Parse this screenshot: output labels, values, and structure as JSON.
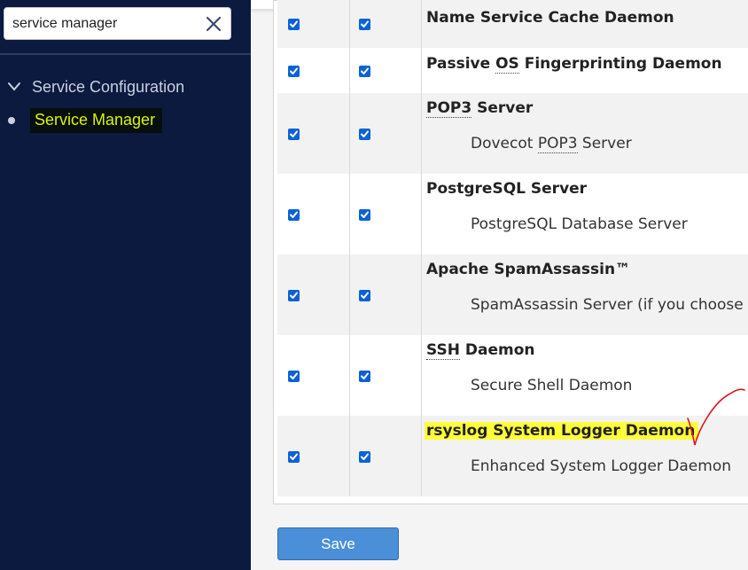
{
  "sidebar": {
    "search": {
      "value": "service manager",
      "placeholder": ""
    },
    "group_label": "Service Configuration",
    "item_label": "Service Manager"
  },
  "services": [
    {
      "name_parts": [
        "Name Service Cache Daemon"
      ],
      "description": "",
      "enabled": true,
      "monitor": true
    },
    {
      "name_parts": [
        "Passive ",
        "OS",
        " Fingerprinting Daemon"
      ],
      "description": "",
      "enabled": true,
      "monitor": true
    },
    {
      "name_parts": [
        "POP3",
        " Server"
      ],
      "desc_parts": [
        "Dovecot ",
        "POP3",
        " Server"
      ],
      "enabled": true,
      "monitor": true
    },
    {
      "name_parts": [
        "PostgreSQL Server"
      ],
      "description": "PostgreSQL Database Server",
      "enabled": true,
      "monitor": true
    },
    {
      "name_parts": [
        "Apache SpamAssassin™"
      ],
      "description": "SpamAssassin Server (if you choose to",
      "enabled": true,
      "monitor": true
    },
    {
      "name_parts": [
        "SSH",
        " Daemon"
      ],
      "description": "Secure Shell Daemon",
      "enabled": true,
      "monitor": true
    },
    {
      "name_parts": [
        "rsyslog System Logger Daemon"
      ],
      "description": "Enhanced System Logger Daemon",
      "enabled": true,
      "monitor": true,
      "highlighted": true
    }
  ],
  "save_label": "Save",
  "colors": {
    "sidebar_bg": "#0c1a40",
    "accent": "#0b62d6",
    "highlight": "#ffff3b",
    "save_bg": "#4a8fd7",
    "annotation": "#e0141e"
  }
}
